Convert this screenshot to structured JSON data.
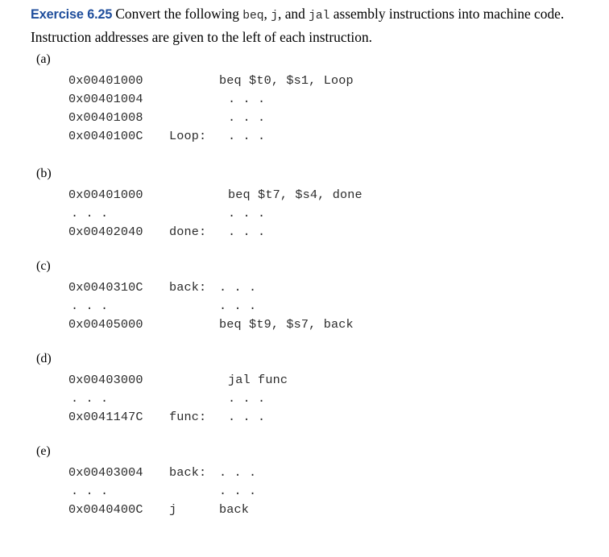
{
  "header": {
    "exercise_tag": "Exercise 6.25",
    "text_part_1": "Convert the following ",
    "code_1": "beq",
    "text_part_2": ", ",
    "code_2": "j",
    "text_part_3": ", and ",
    "code_3": "jal",
    "text_part_4": " assembly instructions into machine code. Instruction addresses are given to the left of each instruction."
  },
  "parts": [
    {
      "label": "(a)",
      "rows": [
        {
          "addr": "0x00401000",
          "label": "",
          "instr": "beq $t0, $s1, Loop",
          "instr_indent": false,
          "addr_ellipsis": false
        },
        {
          "addr": "0x00401004",
          "label": "",
          "instr": ". . .",
          "instr_indent": true,
          "addr_ellipsis": false
        },
        {
          "addr": "0x00401008",
          "label": "",
          "instr": ". . .",
          "instr_indent": true,
          "addr_ellipsis": false
        },
        {
          "addr": "0x0040100C",
          "label": "Loop:",
          "instr": ". . .",
          "instr_indent": true,
          "addr_ellipsis": false
        }
      ]
    },
    {
      "label": "(b)",
      "rows": [
        {
          "addr": "0x00401000",
          "label": "",
          "instr": "beq $t7, $s4, done",
          "instr_indent": true,
          "addr_ellipsis": false
        },
        {
          "addr": ". . .",
          "label": "",
          "instr": ". . .",
          "instr_indent": true,
          "addr_ellipsis": true
        },
        {
          "addr": "0x00402040",
          "label": "done:",
          "instr": ". . .",
          "instr_indent": true,
          "addr_ellipsis": false
        }
      ]
    },
    {
      "label": "(c)",
      "rows": [
        {
          "addr": "0x0040310C",
          "label": "back:",
          "instr": ". . .",
          "instr_indent": false,
          "addr_ellipsis": false
        },
        {
          "addr": ". . .",
          "label": "",
          "instr": ". . .",
          "instr_indent": false,
          "addr_ellipsis": true
        },
        {
          "addr": "0x00405000",
          "label": "",
          "instr": "beq $t9, $s7, back",
          "instr_indent": false,
          "addr_ellipsis": false
        }
      ]
    },
    {
      "label": "(d)",
      "rows": [
        {
          "addr": "0x00403000",
          "label": "",
          "instr": "jal func",
          "instr_indent": true,
          "addr_ellipsis": false
        },
        {
          "addr": ". . .",
          "label": "",
          "instr": ". . .",
          "instr_indent": true,
          "addr_ellipsis": true
        },
        {
          "addr": "0x0041147C",
          "label": "func:",
          "instr": ". . .",
          "instr_indent": true,
          "addr_ellipsis": false
        }
      ]
    },
    {
      "label": "(e)",
      "rows": [
        {
          "addr": "0x00403004",
          "label": "back:",
          "instr": ". . .",
          "instr_indent": false,
          "addr_ellipsis": false
        },
        {
          "addr": ". . .",
          "label": "",
          "instr": ". . .",
          "instr_indent": false,
          "addr_ellipsis": true
        },
        {
          "addr": "0x0040400C",
          "label": "j",
          "instr": "back",
          "instr_indent": false,
          "addr_ellipsis": false
        }
      ]
    }
  ],
  "layout": {
    "part_tops": [
      65,
      207,
      322,
      437,
      552
    ]
  },
  "colors": {
    "exercise_tag": "#1f4e9c",
    "body_text": "#000000",
    "code_text": "#2b2b2b",
    "background": "#ffffff"
  }
}
